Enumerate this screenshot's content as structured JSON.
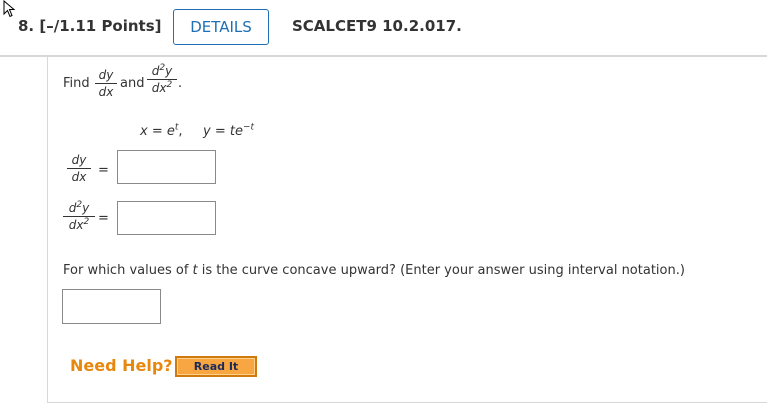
{
  "header": {
    "number": "8.",
    "points": "[–/1.11 Points]",
    "details_label": "DETAILS",
    "reference": "SCALCET9 10.2.017."
  },
  "problem": {
    "find_word": "Find",
    "and_word": "and",
    "period": ".",
    "dy": "dy",
    "dx": "dx",
    "d2y_d": "d",
    "d2y_exp": "2",
    "d2y_y": "y",
    "dx2_base": "dx",
    "dx2_exp": "2",
    "eq_x": "x = e",
    "eq_x_exp": "t",
    "eq_comma": ",",
    "eq_y": "y = te",
    "eq_y_exp": "−t"
  },
  "answers": {
    "equals": "=",
    "dydx_value": "",
    "d2ydx2_value": "",
    "concave_value": ""
  },
  "concave_question": {
    "pre": "For which values of ",
    "var": "t",
    "post": " is the curve concave upward? (Enter your answer using interval notation.)"
  },
  "help": {
    "need_help": "Need Help?",
    "read_it": "Read It"
  },
  "icons": {
    "cursor": "pointer-cursor-icon"
  }
}
